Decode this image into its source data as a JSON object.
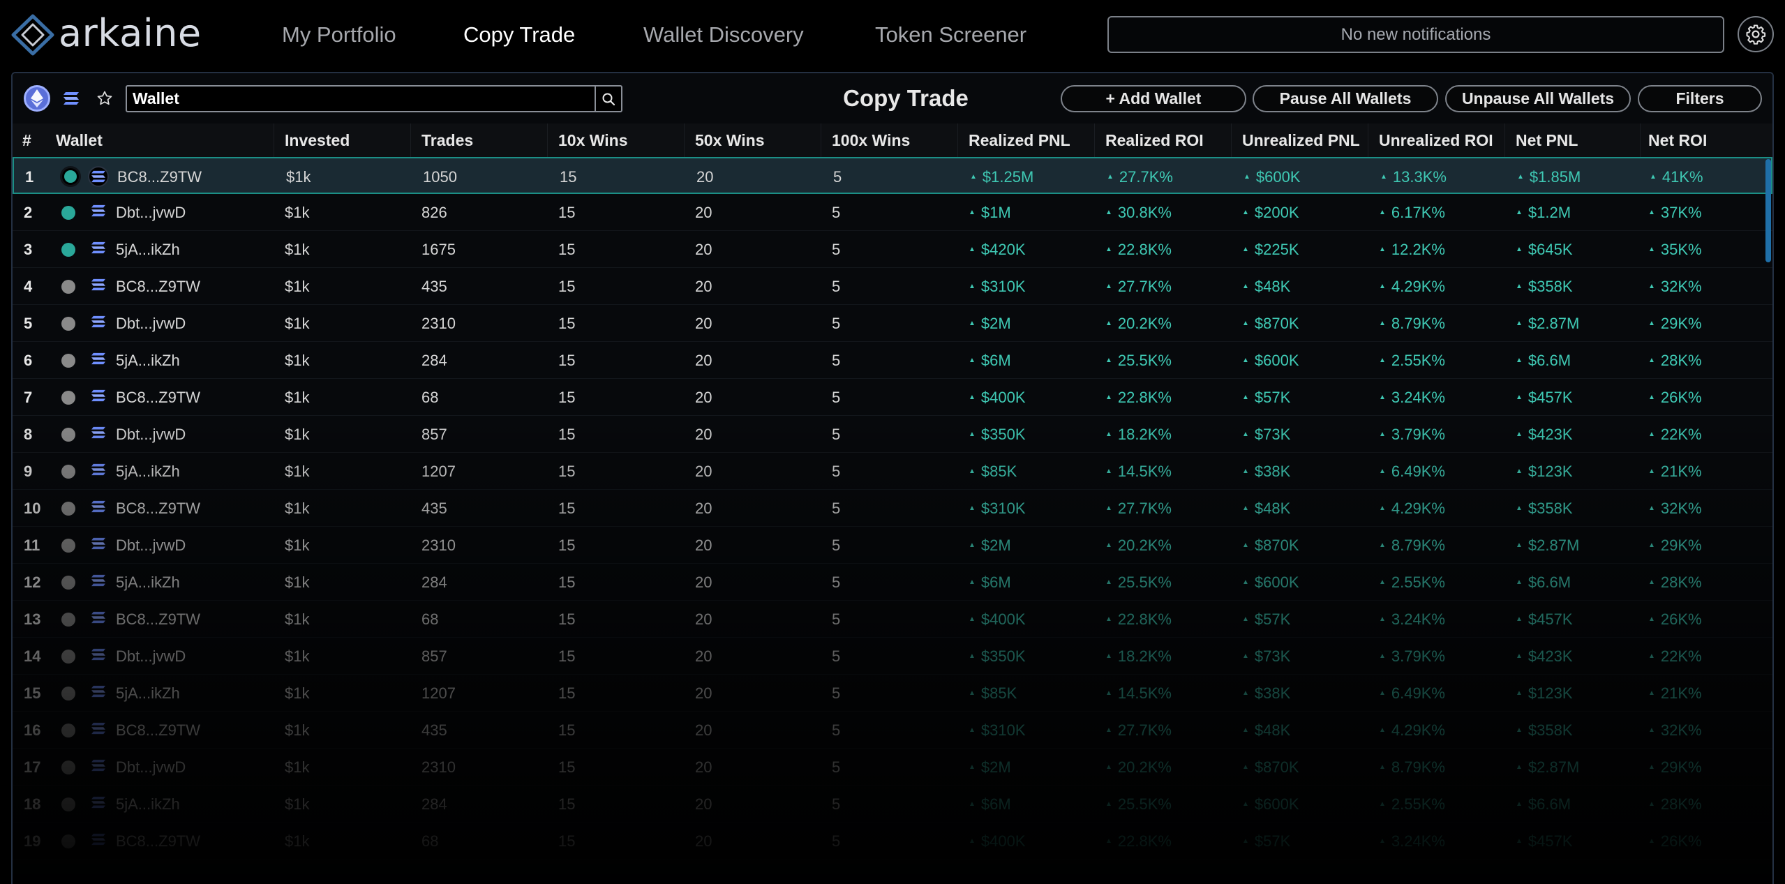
{
  "brand": {
    "name": "arkaine",
    "accent": "#3a6ea5"
  },
  "nav": [
    {
      "label": "My Portfolio",
      "active": false
    },
    {
      "label": "Copy Trade",
      "active": true
    },
    {
      "label": "Wallet Discovery",
      "active": false
    },
    {
      "label": "Token Screener",
      "active": false
    }
  ],
  "notifications": {
    "text": "No new notifications"
  },
  "toolbar": {
    "chain_icons": [
      "ethereum-icon",
      "solana-icon",
      "star-icon"
    ],
    "search_value": "Wallet",
    "title": "Copy Trade",
    "add_wallet": "+ Add Wallet",
    "pause_all": "Pause All Wallets",
    "unpause_all": "Unpause All Wallets",
    "filters": "Filters"
  },
  "colors": {
    "positive": "#3fc9b4",
    "active_dot": "#2aa89a",
    "inactive_dot": "#8a8a8a",
    "selected_row": "#1a2a33"
  },
  "table": {
    "headers": [
      "#",
      "Wallet",
      "Invested",
      "Trades",
      "10x Wins",
      "50x Wins",
      "100x Wins",
      "Realized PNL",
      "Realized ROI",
      "Unrealized PNL",
      "Unrealized ROI",
      "Net PNL",
      "Net ROI"
    ],
    "rows": [
      {
        "num": "1",
        "active": true,
        "wallet": "BC8...Z9TW",
        "invested": "$1k",
        "trades": "1050",
        "w10": "15",
        "w50": "20",
        "w100": "5",
        "rpnl": "$1.25M",
        "rroi": "27.7K%",
        "upnl": "$600K",
        "uroi": "13.3K%",
        "npnl": "$1.85M",
        "nroi": "41K%"
      },
      {
        "num": "2",
        "active": true,
        "wallet": "Dbt...jvwD",
        "invested": "$1k",
        "trades": "826",
        "w10": "15",
        "w50": "20",
        "w100": "5",
        "rpnl": "$1M",
        "rroi": "30.8K%",
        "upnl": "$200K",
        "uroi": "6.17K%",
        "npnl": "$1.2M",
        "nroi": "37K%"
      },
      {
        "num": "3",
        "active": true,
        "wallet": "5jA...ikZh",
        "invested": "$1k",
        "trades": "1675",
        "w10": "15",
        "w50": "20",
        "w100": "5",
        "rpnl": "$420K",
        "rroi": "22.8K%",
        "upnl": "$225K",
        "uroi": "12.2K%",
        "npnl": "$645K",
        "nroi": "35K%"
      },
      {
        "num": "4",
        "active": false,
        "wallet": "BC8...Z9TW",
        "invested": "$1k",
        "trades": "435",
        "w10": "15",
        "w50": "20",
        "w100": "5",
        "rpnl": "$310K",
        "rroi": "27.7K%",
        "upnl": "$48K",
        "uroi": "4.29K%",
        "npnl": "$358K",
        "nroi": "32K%"
      },
      {
        "num": "5",
        "active": false,
        "wallet": "Dbt...jvwD",
        "invested": "$1k",
        "trades": "2310",
        "w10": "15",
        "w50": "20",
        "w100": "5",
        "rpnl": "$2M",
        "rroi": "20.2K%",
        "upnl": "$870K",
        "uroi": "8.79K%",
        "npnl": "$2.87M",
        "nroi": "29K%"
      },
      {
        "num": "6",
        "active": false,
        "wallet": "5jA...ikZh",
        "invested": "$1k",
        "trades": "284",
        "w10": "15",
        "w50": "20",
        "w100": "5",
        "rpnl": "$6M",
        "rroi": "25.5K%",
        "upnl": "$600K",
        "uroi": "2.55K%",
        "npnl": "$6.6M",
        "nroi": "28K%"
      },
      {
        "num": "7",
        "active": false,
        "wallet": "BC8...Z9TW",
        "invested": "$1k",
        "trades": "68",
        "w10": "15",
        "w50": "20",
        "w100": "5",
        "rpnl": "$400K",
        "rroi": "22.8K%",
        "upnl": "$57K",
        "uroi": "3.24K%",
        "npnl": "$457K",
        "nroi": "26K%"
      },
      {
        "num": "8",
        "active": false,
        "wallet": "Dbt...jvwD",
        "invested": "$1k",
        "trades": "857",
        "w10": "15",
        "w50": "20",
        "w100": "5",
        "rpnl": "$350K",
        "rroi": "18.2K%",
        "upnl": "$73K",
        "uroi": "3.79K%",
        "npnl": "$423K",
        "nroi": "22K%"
      },
      {
        "num": "9",
        "active": false,
        "wallet": "5jA...ikZh",
        "invested": "$1k",
        "trades": "1207",
        "w10": "15",
        "w50": "20",
        "w100": "5",
        "rpnl": "$85K",
        "rroi": "14.5K%",
        "upnl": "$38K",
        "uroi": "6.49K%",
        "npnl": "$123K",
        "nroi": "21K%"
      },
      {
        "num": "10",
        "active": false,
        "wallet": "BC8...Z9TW",
        "invested": "$1k",
        "trades": "435",
        "w10": "15",
        "w50": "20",
        "w100": "5",
        "rpnl": "$310K",
        "rroi": "27.7K%",
        "upnl": "$48K",
        "uroi": "4.29K%",
        "npnl": "$358K",
        "nroi": "32K%"
      },
      {
        "num": "11",
        "active": false,
        "wallet": "Dbt...jvwD",
        "invested": "$1k",
        "trades": "2310",
        "w10": "15",
        "w50": "20",
        "w100": "5",
        "rpnl": "$2M",
        "rroi": "20.2K%",
        "upnl": "$870K",
        "uroi": "8.79K%",
        "npnl": "$2.87M",
        "nroi": "29K%"
      },
      {
        "num": "12",
        "active": false,
        "wallet": "5jA...ikZh",
        "invested": "$1k",
        "trades": "284",
        "w10": "15",
        "w50": "20",
        "w100": "5",
        "rpnl": "$6M",
        "rroi": "25.5K%",
        "upnl": "$600K",
        "uroi": "2.55K%",
        "npnl": "$6.6M",
        "nroi": "28K%"
      },
      {
        "num": "13",
        "active": false,
        "wallet": "BC8...Z9TW",
        "invested": "$1k",
        "trades": "68",
        "w10": "15",
        "w50": "20",
        "w100": "5",
        "rpnl": "$400K",
        "rroi": "22.8K%",
        "upnl": "$57K",
        "uroi": "3.24K%",
        "npnl": "$457K",
        "nroi": "26K%"
      },
      {
        "num": "14",
        "active": false,
        "wallet": "Dbt...jvwD",
        "invested": "$1k",
        "trades": "857",
        "w10": "15",
        "w50": "20",
        "w100": "5",
        "rpnl": "$350K",
        "rroi": "18.2K%",
        "upnl": "$73K",
        "uroi": "3.79K%",
        "npnl": "$423K",
        "nroi": "22K%"
      },
      {
        "num": "15",
        "active": false,
        "wallet": "5jA...ikZh",
        "invested": "$1k",
        "trades": "1207",
        "w10": "15",
        "w50": "20",
        "w100": "5",
        "rpnl": "$85K",
        "rroi": "14.5K%",
        "upnl": "$38K",
        "uroi": "6.49K%",
        "npnl": "$123K",
        "nroi": "21K%"
      },
      {
        "num": "16",
        "active": false,
        "wallet": "BC8...Z9TW",
        "invested": "$1k",
        "trades": "435",
        "w10": "15",
        "w50": "20",
        "w100": "5",
        "rpnl": "$310K",
        "rroi": "27.7K%",
        "upnl": "$48K",
        "uroi": "4.29K%",
        "npnl": "$358K",
        "nroi": "32K%"
      },
      {
        "num": "17",
        "active": false,
        "wallet": "Dbt...jvwD",
        "invested": "$1k",
        "trades": "2310",
        "w10": "15",
        "w50": "20",
        "w100": "5",
        "rpnl": "$2M",
        "rroi": "20.2K%",
        "upnl": "$870K",
        "uroi": "8.79K%",
        "npnl": "$2.87M",
        "nroi": "29K%"
      },
      {
        "num": "18",
        "active": false,
        "wallet": "5jA...ikZh",
        "invested": "$1k",
        "trades": "284",
        "w10": "15",
        "w50": "20",
        "w100": "5",
        "rpnl": "$6M",
        "rroi": "25.5K%",
        "upnl": "$600K",
        "uroi": "2.55K%",
        "npnl": "$6.6M",
        "nroi": "28K%"
      },
      {
        "num": "19",
        "active": false,
        "wallet": "BC8...Z9TW",
        "invested": "$1k",
        "trades": "68",
        "w10": "15",
        "w50": "20",
        "w100": "5",
        "rpnl": "$400K",
        "rroi": "22.8K%",
        "upnl": "$57K",
        "uroi": "3.24K%",
        "npnl": "$457K",
        "nroi": "26K%"
      }
    ]
  }
}
